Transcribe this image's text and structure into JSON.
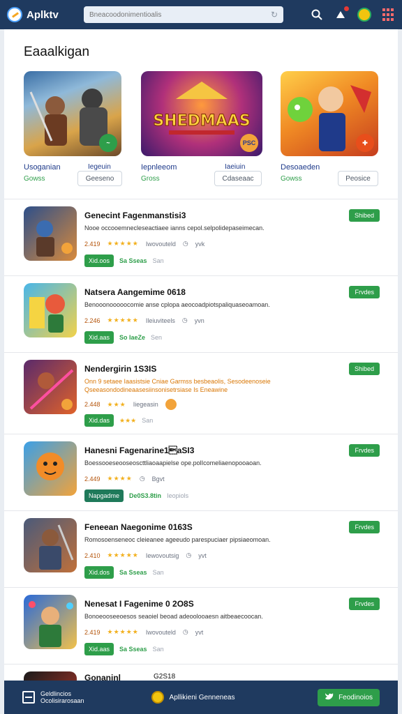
{
  "app": {
    "name": "Aplktv"
  },
  "search": {
    "placeholder": "Bneacoodonimentioalis"
  },
  "header": {
    "section_title": "Eaaalkigan"
  },
  "featured": [
    {
      "title": "Usoganian",
      "subtitle": "Gowss",
      "right_label": "Iegeuin",
      "button": "Geeseno",
      "badge": ""
    },
    {
      "title": "Iepnleeom",
      "subtitle": "Gross",
      "right_label": "Iaeiuin",
      "button": "Cdaseaac",
      "badge": "PSC",
      "art_text": "SHEDMAAS"
    },
    {
      "title": "Desoaeden",
      "subtitle": "Gowss",
      "right_label": "",
      "button": "Peosice",
      "badge": ""
    }
  ],
  "list": [
    {
      "title": "Genecint Fagenmanstisi3",
      "desc": "Nooe occooemnecleseactiaee ianns cepol.selpolidepaseimecan.",
      "rating": "2.419",
      "stars": "★★★★★",
      "extra1": "Iwovouteld",
      "extra2": "yvk",
      "download": "Xid.oos",
      "price": "Sa Sseas",
      "tail": "San",
      "pill": "Shibed"
    },
    {
      "title": "Natsera Aangemime 0618",
      "desc": "Benooonooooocomie anse cplopa aeocoadpiotspaliquaseoamoan.",
      "rating": "2.246",
      "stars": "★★★★★",
      "extra1": "Ileiuviteels",
      "extra2": "yvn",
      "download": "Xid.aas",
      "price": "So IaeZe",
      "tail": "Sen",
      "pill": "Frvdes"
    },
    {
      "title": "Nendergirin 1S3IS",
      "desc": "Onn 9 setaee Iaasistsie Cniae Garmss besbeaolis, Sesodeenoseie Qseeasondodineaasesiinsonisetrsiase Is Eneawine",
      "rating": "2.448",
      "stars": "★★★",
      "extra1": "Iiegeasin",
      "extra2": "",
      "download": "Xid.das",
      "price": "",
      "tail": "San",
      "pill": "Shibed"
    },
    {
      "title": "Hanesni Fagenarine1\u0019aSI3",
      "desc": "Boessooeseooseoscttliaoaapielse ope.polIcomeliaenopooaoan.",
      "rating": "2.449",
      "stars": "★★★★",
      "extra1": "",
      "extra2": "Bgvt",
      "download": "Napgadme",
      "price": "De0S3.8tin",
      "tail": "Ieopiols",
      "pill": "Frvdes"
    },
    {
      "title": "Feneean Naegonime 0163S",
      "desc": "Romosoenseneoc cleieanee ageeudo parespuciaer pipsiaeomoan.",
      "rating": "2.410",
      "stars": "★★★★★",
      "extra1": "Iewovoutsig",
      "extra2": "yvt",
      "download": "Xid.dos",
      "price": "Sa Sseas",
      "tail": "San",
      "pill": "Frvdes"
    },
    {
      "title": "Nenesat I Fagenime 0 2O8S",
      "desc": "Bonoeooseeoesos seaoiel beoad adeoolooaesn aitbeaecoocan.",
      "rating": "2.419",
      "stars": "★★★★★",
      "extra1": "Iwovouteld",
      "extra2": "yvt",
      "download": "Xid.aas",
      "price": "Sa Sseas",
      "tail": "San",
      "pill": "Frvdes"
    },
    {
      "title": "Gonaninl",
      "desc": "",
      "rating": "",
      "stars": "",
      "extra1": "",
      "extra2": "",
      "download": "",
      "price": "",
      "tail": "",
      "pill": "",
      "right_small": "G2S18"
    }
  ],
  "bottom": {
    "left_line1": "Geldlincios",
    "left_line2": "Ocolisirarosaan",
    "center": "Apllikieni  Genneneas",
    "button": "Feodinoios"
  },
  "colors": {
    "topbar": "#1f3a5f",
    "accent_green": "#2e9e4a",
    "stars": "#f2b01e"
  }
}
